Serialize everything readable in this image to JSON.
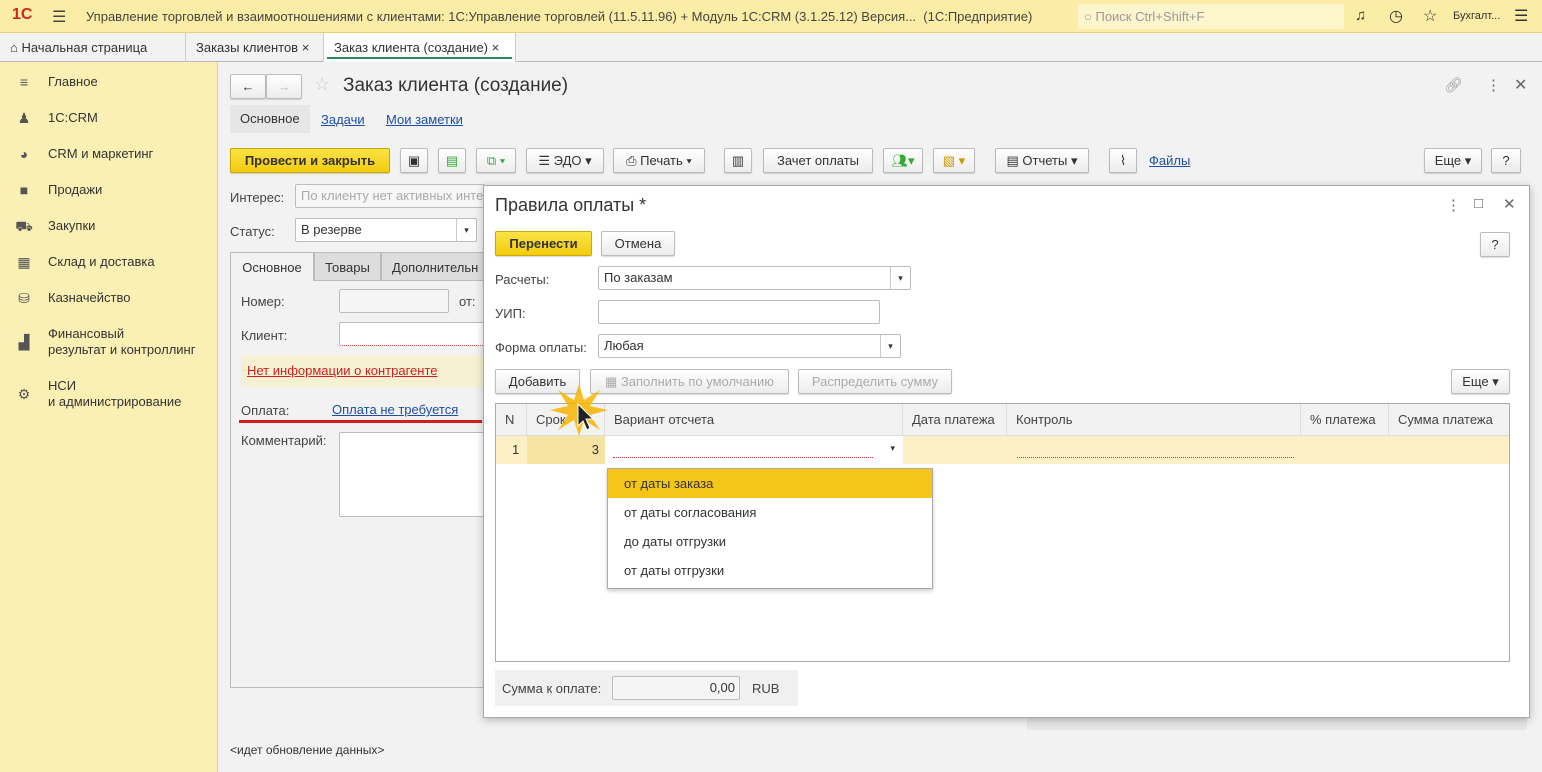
{
  "titlebar": {
    "logo": "1С",
    "title": "Управление торговлей и взаимоотношениями с клиентами: 1С:Управление торговлей (11.5.11.96) + Модуль 1С:CRM (3.1.25.12) Версия...  (1С:Предприятие)",
    "search_placeholder": "Поиск Ctrl+Shift+F",
    "user": "Бухгалт..."
  },
  "tabs": [
    {
      "label": "Начальная страница"
    },
    {
      "label": "Заказы клиентов"
    },
    {
      "label": "Заказ клиента (создание)"
    }
  ],
  "sidebar": {
    "items": [
      {
        "label": "Главное",
        "icon": "menu-icon"
      },
      {
        "label": "1С:CRM",
        "icon": "users-icon"
      },
      {
        "label": "CRM и маркетинг",
        "icon": "pie-chart-icon"
      },
      {
        "label": "Продажи",
        "icon": "bag-icon"
      },
      {
        "label": "Закупки",
        "icon": "cart-icon"
      },
      {
        "label": "Склад и доставка",
        "icon": "grid-icon"
      },
      {
        "label": "Казначейство",
        "icon": "coins-icon"
      },
      {
        "label": "Финансовый\nрезультат и контроллинг",
        "icon": "bar-chart-icon"
      },
      {
        "label": "НСИ\nи администрирование",
        "icon": "gear-icon"
      }
    ]
  },
  "form": {
    "title": "Заказ клиента (создание)",
    "subtabs": [
      "Основное",
      "Задачи",
      "Мои заметки"
    ],
    "toolbar": {
      "post_close": "Провести и закрыть",
      "edo": "ЭДО",
      "print": "Печать",
      "offset": "Зачет оплаты",
      "reports": "Отчеты",
      "files": "Файлы",
      "more": "Еще",
      "help": "?"
    },
    "interest_label": "Интерес:",
    "interest_placeholder": "По клиенту нет активных инте",
    "status_label": "Статус:",
    "status_value": "В резерве",
    "inner_tabs": [
      "Основное",
      "Товары",
      "Дополнительн"
    ],
    "number_label": "Номер:",
    "from_label": "от:",
    "client_label": "Клиент:",
    "no_info": "Нет информации о контрагенте",
    "payment_label": "Оплата:",
    "payment_value": "Оплата не требуется",
    "comment_label": "Комментарий:",
    "status_bar": "<идет обновление данных>"
  },
  "dialog": {
    "title": "Правила оплаты *",
    "transfer": "Перенести",
    "cancel": "Отмена",
    "help": "?",
    "settlements_label": "Расчеты:",
    "settlements_value": "По заказам",
    "uip_label": "УИП:",
    "uip_value": "",
    "form_label": "Форма оплаты:",
    "form_value": "Любая",
    "add": "Добавить",
    "fill_default": "Заполнить по умолчанию",
    "distribute": "Распределить сумму",
    "more": "Еще",
    "columns": [
      "N",
      "Срок",
      "Вариант отсчета",
      "Дата платежа",
      "Контроль",
      "% платежа",
      "Сумма платежа"
    ],
    "rows": [
      {
        "n": "1",
        "term": "3",
        "variant": "",
        "date": "",
        "control": "",
        "percent": "",
        "sum": ""
      }
    ],
    "dropdown_options": [
      "от даты заказа",
      "от даты согласования",
      "до даты отгрузки",
      "от даты отгрузки"
    ],
    "selected_option": 0,
    "total_label": "Сумма к оплате:",
    "total_value": "0,00",
    "currency": "RUB"
  },
  "colors": {
    "accent_yellow": "#f5d320",
    "sidebar": "#fbf0b4",
    "link": "#1c4fa5",
    "warning_red": "#d11f1f"
  }
}
